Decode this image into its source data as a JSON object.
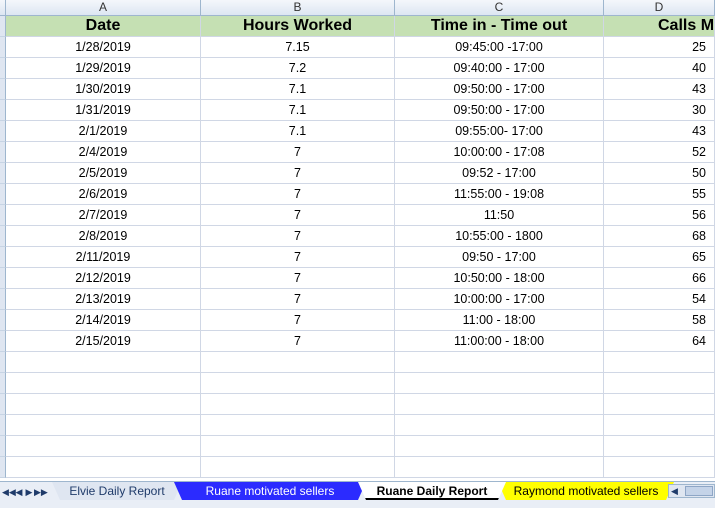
{
  "columns": [
    "A",
    "B",
    "C",
    "D"
  ],
  "header": {
    "date": "Date",
    "hours": "Hours Worked",
    "time": "Time in - Time out",
    "calls": "Calls Ma"
  },
  "rows": [
    {
      "date": "1/28/2019",
      "hours": "7.15",
      "time": "09:45:00 -17:00",
      "calls": "25"
    },
    {
      "date": "1/29/2019",
      "hours": "7.2",
      "time": "09:40:00 - 17:00",
      "calls": "40"
    },
    {
      "date": "1/30/2019",
      "hours": "7.1",
      "time": "09:50:00 - 17:00",
      "calls": "43"
    },
    {
      "date": "1/31/2019",
      "hours": "7.1",
      "time": "09:50:00 - 17:00",
      "calls": "30"
    },
    {
      "date": "2/1/2019",
      "hours": "7.1",
      "time": "09:55:00- 17:00",
      "calls": "43"
    },
    {
      "date": "2/4/2019",
      "hours": "7",
      "time": "10:00:00 - 17:08",
      "calls": "52"
    },
    {
      "date": "2/5/2019",
      "hours": "7",
      "time": "09:52 - 17:00",
      "calls": "50"
    },
    {
      "date": "2/6/2019",
      "hours": "7",
      "time": "11:55:00 - 19:08",
      "calls": "55"
    },
    {
      "date": "2/7/2019",
      "hours": "7",
      "time": "11:50",
      "calls": "56"
    },
    {
      "date": "2/8/2019",
      "hours": "7",
      "time": "10:55:00 - 1800",
      "calls": "68"
    },
    {
      "date": "2/11/2019",
      "hours": "7",
      "time": "09:50 - 17:00",
      "calls": "65"
    },
    {
      "date": "2/12/2019",
      "hours": "7",
      "time": "10:50:00 - 18:00",
      "calls": "66"
    },
    {
      "date": "2/13/2019",
      "hours": "7",
      "time": "10:00:00 - 17:00",
      "calls": "54"
    },
    {
      "date": "2/14/2019",
      "hours": "7",
      "time": "11:00 - 18:00",
      "calls": "58"
    },
    {
      "date": "2/15/2019",
      "hours": "7",
      "time": "11:00:00 - 18:00",
      "calls": "64"
    }
  ],
  "empty_rows": 6,
  "tabs": [
    {
      "label": "Elvie Daily Report",
      "color": "#dfe6f1"
    },
    {
      "label": "Ruane motivated sellers",
      "color": "#2b2bff"
    },
    {
      "label": "Ruane Daily Report",
      "active": true
    },
    {
      "label": "Raymond motivated sellers",
      "color": "#ffff00"
    }
  ],
  "colors": {
    "header_fill": "#c5e0b3",
    "gridline": "#d0d7e5"
  }
}
